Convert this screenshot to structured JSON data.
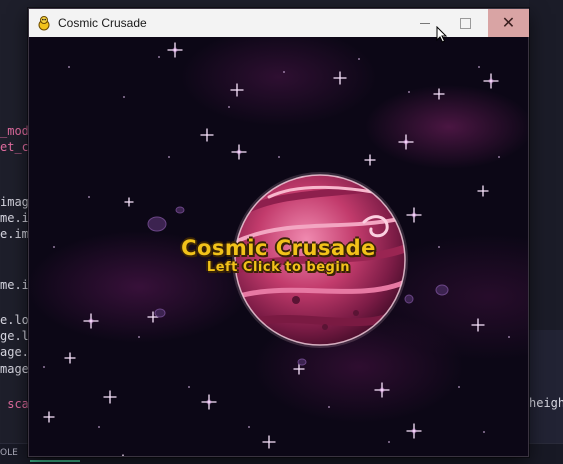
{
  "window": {
    "title": "Cosmic Crusade",
    "controls": {
      "minimize_icon": "minimize-icon",
      "maximize_icon": "maximize-icon",
      "close_glyph": "✕"
    }
  },
  "game": {
    "title": "Cosmic Crusade",
    "subtitle": "Left Click to begin"
  },
  "editor": {
    "lines": [
      {
        "text": "_mod",
        "accent": true
      },
      {
        "text": "et_ca",
        "accent": true
      },
      {
        "text": "imag",
        "accent": false
      },
      {
        "text": "me.im",
        "accent": false
      },
      {
        "text": "e.ima",
        "accent": false
      },
      {
        "text": "me.i",
        "accent": false
      },
      {
        "text": "e.loa",
        "accent": false
      },
      {
        "text": "ge.lo",
        "accent": false
      },
      {
        "text": "age.l",
        "accent": false
      },
      {
        "text": "mage.",
        "accent": false
      },
      {
        "text": " scal",
        "accent": true
      }
    ],
    "right_text": "heigh",
    "status_text": "OLE"
  },
  "colors": {
    "title_text": "#f2c21a",
    "title_outline": "#3a2406",
    "close_button_bg": "#d9a4a4",
    "space_bg": "#0c0716"
  }
}
